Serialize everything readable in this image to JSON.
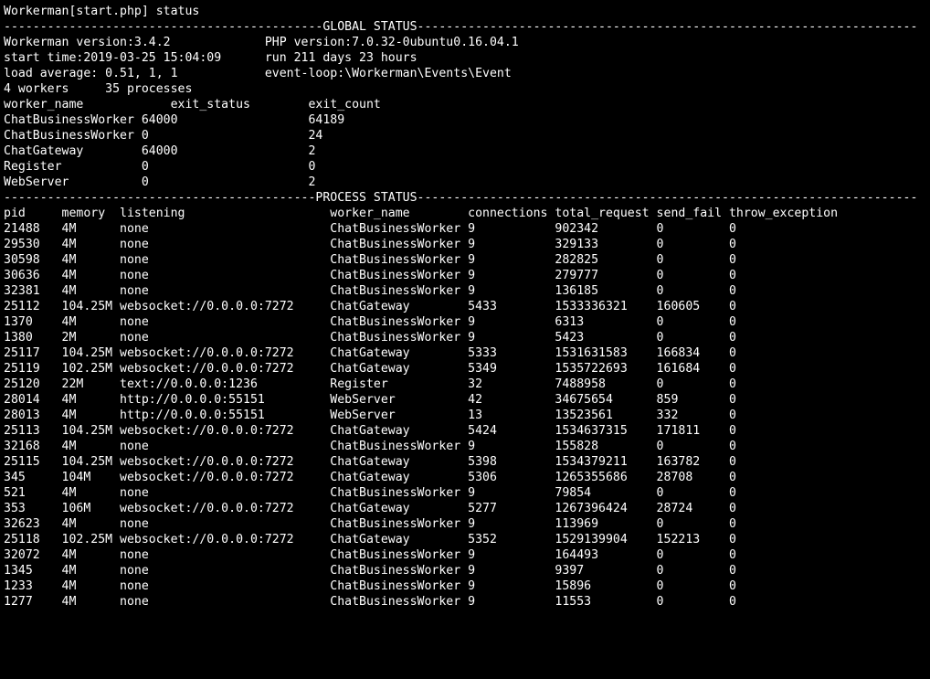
{
  "title": "Workerman[start.php] status",
  "global_header": "GLOBAL STATUS",
  "process_header": "PROCESS STATUS",
  "global": {
    "version_label": "Workerman version:",
    "version": "3.4.2",
    "php_label": "PHP version:",
    "php_version": "7.0.32-0ubuntu0.16.04.1",
    "start_label": "start time:",
    "start_time": "2019-03-25 15:04:09",
    "run_label": "run",
    "run_time": "211 days 23 hours",
    "load_label": "load average:",
    "load_avg": "0.51, 1, 1",
    "event_loop_label": "event-loop:",
    "event_loop": "\\Workerman\\Events\\Event",
    "workers_count": "4",
    "workers_label": "workers",
    "processes_count": "35",
    "processes_label": "processes",
    "hdr_worker_name": "worker_name",
    "hdr_exit_status": "exit_status",
    "hdr_exit_count": "exit_count",
    "exit_rows": [
      {
        "name": "ChatBusinessWorker",
        "status": "64000",
        "count": "64189"
      },
      {
        "name": "ChatBusinessWorker",
        "status": "0",
        "count": "24"
      },
      {
        "name": "ChatGateway",
        "status": "64000",
        "count": "2"
      },
      {
        "name": "Register",
        "status": "0",
        "count": "0"
      },
      {
        "name": "WebServer",
        "status": "0",
        "count": "2"
      }
    ]
  },
  "proc_headers": {
    "pid": "pid",
    "memory": "memory",
    "listening": "listening",
    "worker_name": "worker_name",
    "connections": "connections",
    "total_request": "total_request",
    "send_fail": "send_fail",
    "throw_exception": "throw_exception"
  },
  "processes": [
    {
      "pid": "21488",
      "memory": "4M",
      "listening": "none",
      "worker_name": "ChatBusinessWorker",
      "connections": "9",
      "total_request": "902342",
      "send_fail": "0",
      "throw_exception": "0"
    },
    {
      "pid": "29530",
      "memory": "4M",
      "listening": "none",
      "worker_name": "ChatBusinessWorker",
      "connections": "9",
      "total_request": "329133",
      "send_fail": "0",
      "throw_exception": "0"
    },
    {
      "pid": "30598",
      "memory": "4M",
      "listening": "none",
      "worker_name": "ChatBusinessWorker",
      "connections": "9",
      "total_request": "282825",
      "send_fail": "0",
      "throw_exception": "0"
    },
    {
      "pid": "30636",
      "memory": "4M",
      "listening": "none",
      "worker_name": "ChatBusinessWorker",
      "connections": "9",
      "total_request": "279777",
      "send_fail": "0",
      "throw_exception": "0"
    },
    {
      "pid": "32381",
      "memory": "4M",
      "listening": "none",
      "worker_name": "ChatBusinessWorker",
      "connections": "9",
      "total_request": "136185",
      "send_fail": "0",
      "throw_exception": "0"
    },
    {
      "pid": "25112",
      "memory": "104.25M",
      "listening": "websocket://0.0.0.0:7272",
      "worker_name": "ChatGateway",
      "connections": "5433",
      "total_request": "1533336321",
      "send_fail": "160605",
      "throw_exception": "0"
    },
    {
      "pid": "1370",
      "memory": "4M",
      "listening": "none",
      "worker_name": "ChatBusinessWorker",
      "connections": "9",
      "total_request": "6313",
      "send_fail": "0",
      "throw_exception": "0"
    },
    {
      "pid": "1380",
      "memory": "2M",
      "listening": "none",
      "worker_name": "ChatBusinessWorker",
      "connections": "9",
      "total_request": "5423",
      "send_fail": "0",
      "throw_exception": "0"
    },
    {
      "pid": "25117",
      "memory": "104.25M",
      "listening": "websocket://0.0.0.0:7272",
      "worker_name": "ChatGateway",
      "connections": "5333",
      "total_request": "1531631583",
      "send_fail": "166834",
      "throw_exception": "0"
    },
    {
      "pid": "25119",
      "memory": "102.25M",
      "listening": "websocket://0.0.0.0:7272",
      "worker_name": "ChatGateway",
      "connections": "5349",
      "total_request": "1535722693",
      "send_fail": "161684",
      "throw_exception": "0"
    },
    {
      "pid": "25120",
      "memory": "22M",
      "listening": "text://0.0.0.0:1236",
      "worker_name": "Register",
      "connections": "32",
      "total_request": "7488958",
      "send_fail": "0",
      "throw_exception": "0"
    },
    {
      "pid": "28014",
      "memory": "4M",
      "listening": "http://0.0.0.0:55151",
      "worker_name": "WebServer",
      "connections": "42",
      "total_request": "34675654",
      "send_fail": "859",
      "throw_exception": "0"
    },
    {
      "pid": "28013",
      "memory": "4M",
      "listening": "http://0.0.0.0:55151",
      "worker_name": "WebServer",
      "connections": "13",
      "total_request": "13523561",
      "send_fail": "332",
      "throw_exception": "0"
    },
    {
      "pid": "25113",
      "memory": "104.25M",
      "listening": "websocket://0.0.0.0:7272",
      "worker_name": "ChatGateway",
      "connections": "5424",
      "total_request": "1534637315",
      "send_fail": "171811",
      "throw_exception": "0"
    },
    {
      "pid": "32168",
      "memory": "4M",
      "listening": "none",
      "worker_name": "ChatBusinessWorker",
      "connections": "9",
      "total_request": "155828",
      "send_fail": "0",
      "throw_exception": "0"
    },
    {
      "pid": "25115",
      "memory": "104.25M",
      "listening": "websocket://0.0.0.0:7272",
      "worker_name": "ChatGateway",
      "connections": "5398",
      "total_request": "1534379211",
      "send_fail": "163782",
      "throw_exception": "0"
    },
    {
      "pid": "345",
      "memory": "104M",
      "listening": "websocket://0.0.0.0:7272",
      "worker_name": "ChatGateway",
      "connections": "5306",
      "total_request": "1265355686",
      "send_fail": "28708",
      "throw_exception": "0"
    },
    {
      "pid": "521",
      "memory": "4M",
      "listening": "none",
      "worker_name": "ChatBusinessWorker",
      "connections": "9",
      "total_request": "79854",
      "send_fail": "0",
      "throw_exception": "0"
    },
    {
      "pid": "353",
      "memory": "106M",
      "listening": "websocket://0.0.0.0:7272",
      "worker_name": "ChatGateway",
      "connections": "5277",
      "total_request": "1267396424",
      "send_fail": "28724",
      "throw_exception": "0"
    },
    {
      "pid": "32623",
      "memory": "4M",
      "listening": "none",
      "worker_name": "ChatBusinessWorker",
      "connections": "9",
      "total_request": "113969",
      "send_fail": "0",
      "throw_exception": "0"
    },
    {
      "pid": "25118",
      "memory": "102.25M",
      "listening": "websocket://0.0.0.0:7272",
      "worker_name": "ChatGateway",
      "connections": "5352",
      "total_request": "1529139904",
      "send_fail": "152213",
      "throw_exception": "0"
    },
    {
      "pid": "32072",
      "memory": "4M",
      "listening": "none",
      "worker_name": "ChatBusinessWorker",
      "connections": "9",
      "total_request": "164493",
      "send_fail": "0",
      "throw_exception": "0"
    },
    {
      "pid": "1345",
      "memory": "4M",
      "listening": "none",
      "worker_name": "ChatBusinessWorker",
      "connections": "9",
      "total_request": "9397",
      "send_fail": "0",
      "throw_exception": "0"
    },
    {
      "pid": "1233",
      "memory": "4M",
      "listening": "none",
      "worker_name": "ChatBusinessWorker",
      "connections": "9",
      "total_request": "15896",
      "send_fail": "0",
      "throw_exception": "0"
    },
    {
      "pid": "1277",
      "memory": "4M",
      "listening": "none",
      "worker_name": "ChatBusinessWorker",
      "connections": "9",
      "total_request": "11553",
      "send_fail": "0",
      "throw_exception": "0"
    }
  ]
}
